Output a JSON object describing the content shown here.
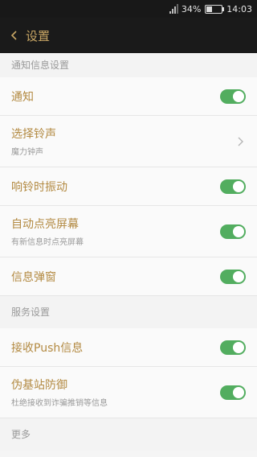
{
  "status_bar": {
    "battery": "34%",
    "time": "14:03"
  },
  "nav": {
    "back_icon": "chevron-left-icon",
    "title": "设置"
  },
  "sections": {
    "notification_header": "通知信息设置",
    "service_header": "服务设置",
    "more": "更多"
  },
  "items": [
    {
      "label": "通知",
      "control": "toggle",
      "on": true
    },
    {
      "label": "选择铃声",
      "sub": "魔力钟声",
      "control": "chevron"
    },
    {
      "label": "响铃时振动",
      "control": "toggle",
      "on": true
    },
    {
      "label": "自动点亮屏幕",
      "sub": "有新信息时点亮屏幕",
      "control": "toggle",
      "on": true
    },
    {
      "label": "信息弹窗",
      "control": "toggle",
      "on": true
    },
    {
      "label": "接收Push信息",
      "control": "toggle",
      "on": true
    },
    {
      "label": "伪基站防御",
      "sub": "杜绝接收到诈骗推销等信息",
      "control": "toggle",
      "on": true
    }
  ],
  "colors": {
    "accent": "#b38a42",
    "nav_bg": "#1a1a1a",
    "toggle_on": "#52ad5f"
  }
}
